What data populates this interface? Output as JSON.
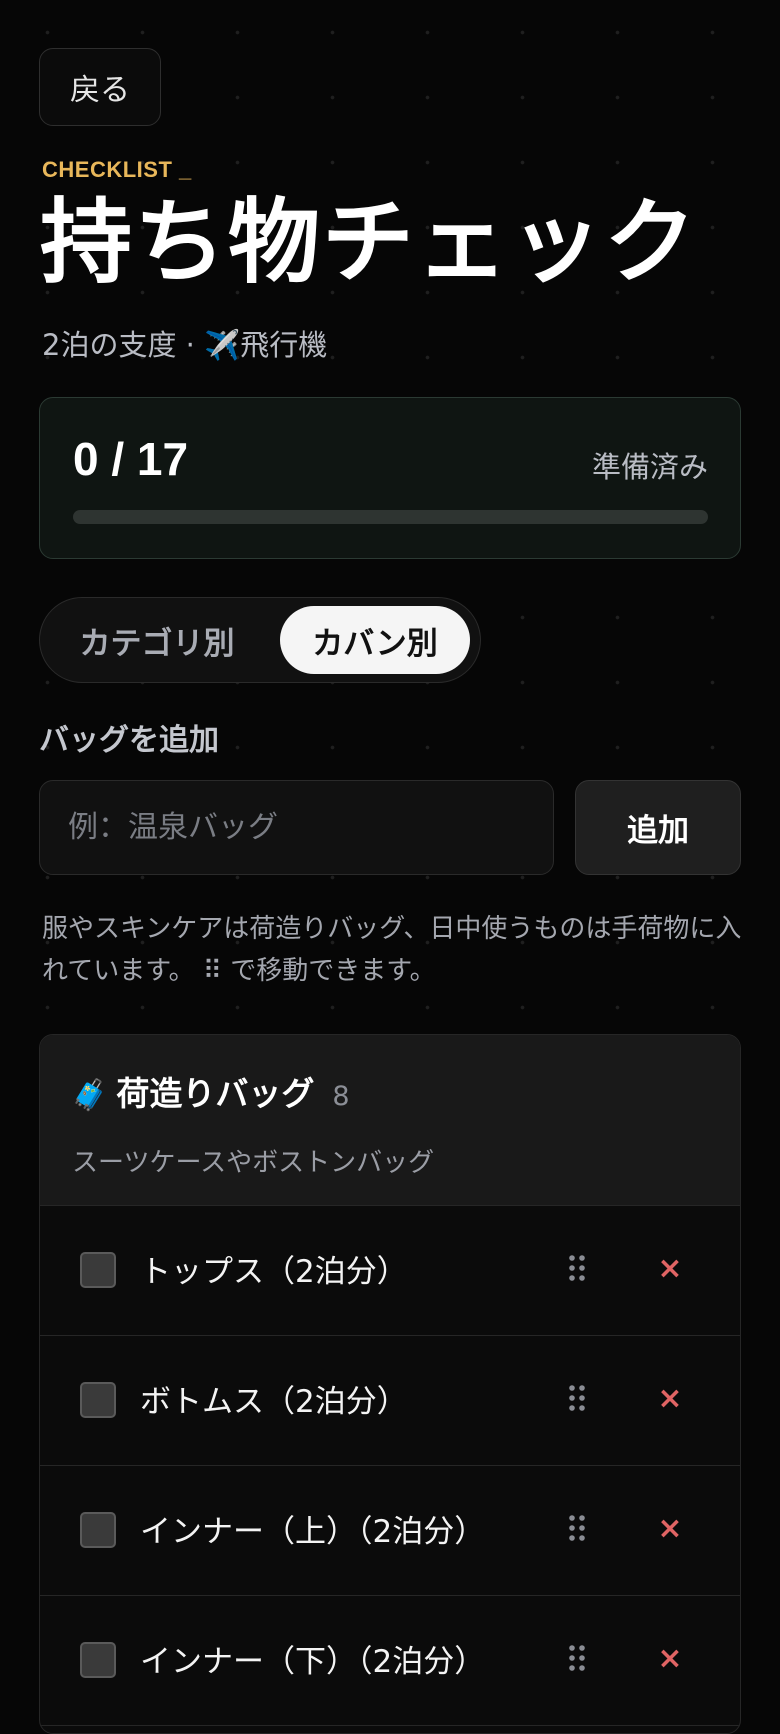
{
  "header": {
    "back_label": "戻る",
    "eyebrow": "CHECKLIST _",
    "title": "持ち物チェック",
    "subtitle": "2泊の支度 · ✈️飛行機"
  },
  "progress": {
    "count": "0 / 17",
    "label": "準備済み",
    "checked": 0,
    "total": 17,
    "fill_color": "#49c07a"
  },
  "view_toggle": {
    "options": [
      "カテゴリ別",
      "カバン別"
    ],
    "selected": "カバン別"
  },
  "add_bag": {
    "label": "バッグを追加",
    "placeholder": "例：温泉バッグ",
    "value": "",
    "button_label": "追加"
  },
  "hint": {
    "text_before": "服やスキンケアは荷造りバッグ、日中使うものは手荷物に入れています。",
    "grip": "⠿",
    "text_after": " で移動できます。"
  },
  "bag": {
    "icon": "🧳",
    "icon_name": "suitcase-icon",
    "name": "荷造りバッグ",
    "count": "8",
    "description": "スーツケースやボストンバッグ",
    "items": [
      {
        "label": "トップス（2泊分）",
        "checked": false
      },
      {
        "label": "ボトムス（2泊分）",
        "checked": false
      },
      {
        "label": "インナー（上）（2泊分）",
        "checked": false
      },
      {
        "label": "インナー（下）（2泊分）",
        "checked": false
      }
    ],
    "delete_symbol": "×"
  },
  "colors": {
    "accent": "#e8b75a",
    "delete": "#e06464",
    "background": "#060606"
  }
}
